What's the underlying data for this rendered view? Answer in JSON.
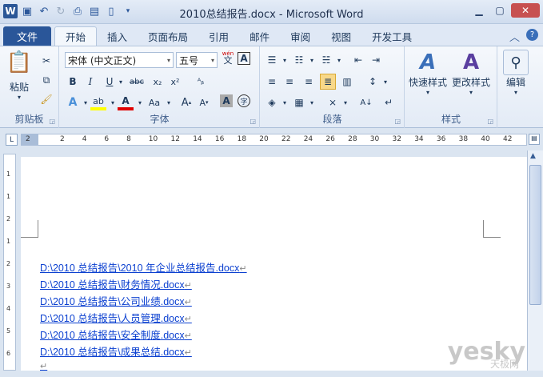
{
  "window": {
    "title": "2010总结报告.docx - Microsoft Word",
    "minimize_icon": "minimize-icon",
    "maximize_icon": "maximize-icon",
    "close_icon": "close-icon"
  },
  "qat": {
    "logo": "W"
  },
  "tabs": {
    "file": "文件",
    "items": [
      "开始",
      "插入",
      "页面布局",
      "引用",
      "邮件",
      "审阅",
      "视图",
      "开发工具"
    ],
    "active": "开始"
  },
  "ribbon": {
    "clipboard": {
      "label": "剪贴板",
      "paste": "粘贴"
    },
    "font": {
      "label": "字体",
      "font_name": "宋体 (中文正文)",
      "font_size": "五号",
      "wen": "wén"
    },
    "paragraph": {
      "label": "段落"
    },
    "styles": {
      "label": "样式",
      "quick_styles": "快速样式",
      "change_styles": "更改样式"
    },
    "editing": {
      "label": "编辑"
    }
  },
  "ruler": {
    "numbers": [
      "2",
      "2",
      "4",
      "6",
      "8",
      "10",
      "12",
      "14",
      "16",
      "18",
      "20",
      "22",
      "24",
      "26",
      "28",
      "30",
      "32",
      "34",
      "36",
      "38",
      "40",
      "42"
    ],
    "vertical_numbers": [
      "1",
      "1",
      "2",
      "1",
      "2",
      "3",
      "4",
      "5",
      "6"
    ]
  },
  "document": {
    "lines": [
      "D:\\2010 总结报告\\2010 年企业总结报告.docx",
      "D:\\2010 总结报告\\财务情况.docx",
      "D:\\2010 总结报告\\公司业绩.docx",
      "D:\\2010 总结报告\\人员管理.docx",
      "D:\\2010 总结报告\\安全制度.docx",
      "D:\\2010 总结报告\\成果总结.docx"
    ],
    "para_mark": "↵"
  },
  "watermark": {
    "brand": "yesky",
    "sub": "天极网"
  },
  "colors": {
    "file_tab": "#2a5699",
    "link": "#0b40d0",
    "selected": "#f8d889"
  }
}
